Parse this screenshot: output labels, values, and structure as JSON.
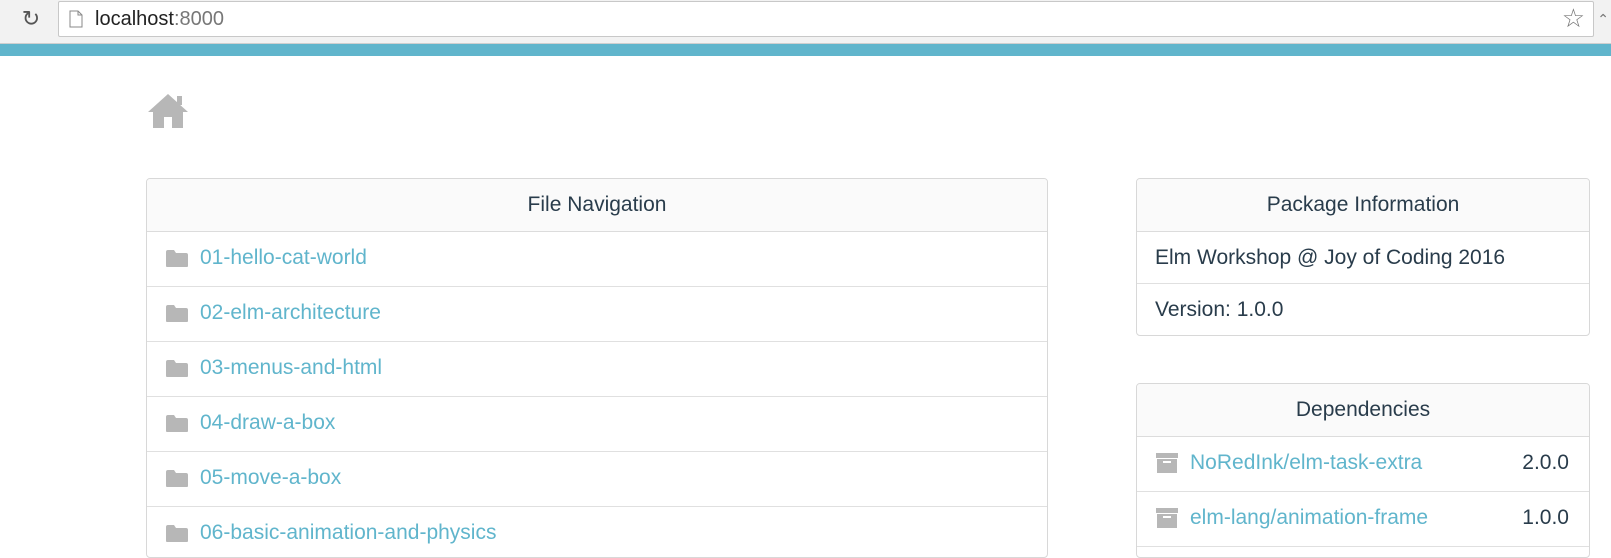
{
  "browser": {
    "url_host": "localhost",
    "url_port": ":8000"
  },
  "colors": {
    "accent": "#60b5cc",
    "text": "#293c4b",
    "icon_gray": "#b7b7b7"
  },
  "file_navigation": {
    "title": "File Navigation",
    "items": [
      {
        "label": "01-hello-cat-world",
        "icon": "folder-icon"
      },
      {
        "label": "02-elm-architecture",
        "icon": "folder-icon"
      },
      {
        "label": "03-menus-and-html",
        "icon": "folder-icon"
      },
      {
        "label": "04-draw-a-box",
        "icon": "folder-icon"
      },
      {
        "label": "05-move-a-box",
        "icon": "folder-icon"
      },
      {
        "label": "06-basic-animation-and-physics",
        "icon": "folder-icon"
      }
    ]
  },
  "package_information": {
    "title": "Package Information",
    "name": "Elm Workshop @ Joy of Coding 2016",
    "version": "Version: 1.0.0"
  },
  "dependencies": {
    "title": "Dependencies",
    "items": [
      {
        "name": "NoRedInk/elm-task-extra",
        "version": "2.0.0",
        "icon": "archive-icon"
      },
      {
        "name": "elm-lang/animation-frame",
        "version": "1.0.0",
        "icon": "archive-icon"
      }
    ]
  }
}
